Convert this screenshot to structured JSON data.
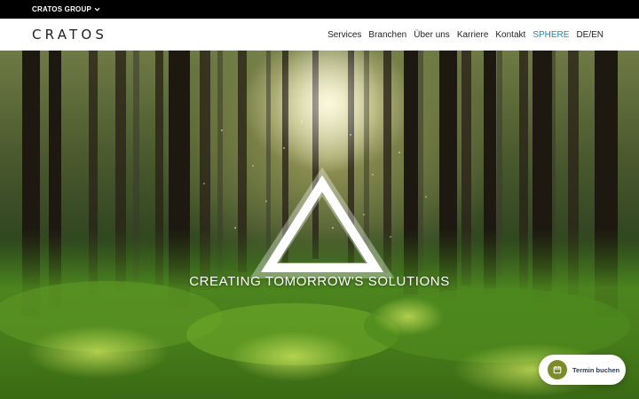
{
  "topbar": {
    "group_label": "CRATOS GROUP",
    "chevron_icon": "chevron-down-icon"
  },
  "header": {
    "logo_text": "CRATOS",
    "nav": [
      {
        "label": "Services"
      },
      {
        "label": "Branchen"
      },
      {
        "label": "Über uns"
      },
      {
        "label": "Karriere"
      },
      {
        "label": "Kontakt"
      },
      {
        "label": "SPHERE",
        "accent": true
      },
      {
        "label": "DE/EN"
      }
    ]
  },
  "hero": {
    "tagline": "CREATING TOMORROW'S SOLUTIONS",
    "emblem_icon": "glowing-triangle-icon"
  },
  "booking": {
    "label": "Termin buchen",
    "icon": "calendar-icon"
  },
  "colors": {
    "accent_nav": "#2a7fa8",
    "booking_icon_bg": "#7c8c2a",
    "booking_text": "#2a3b55"
  }
}
